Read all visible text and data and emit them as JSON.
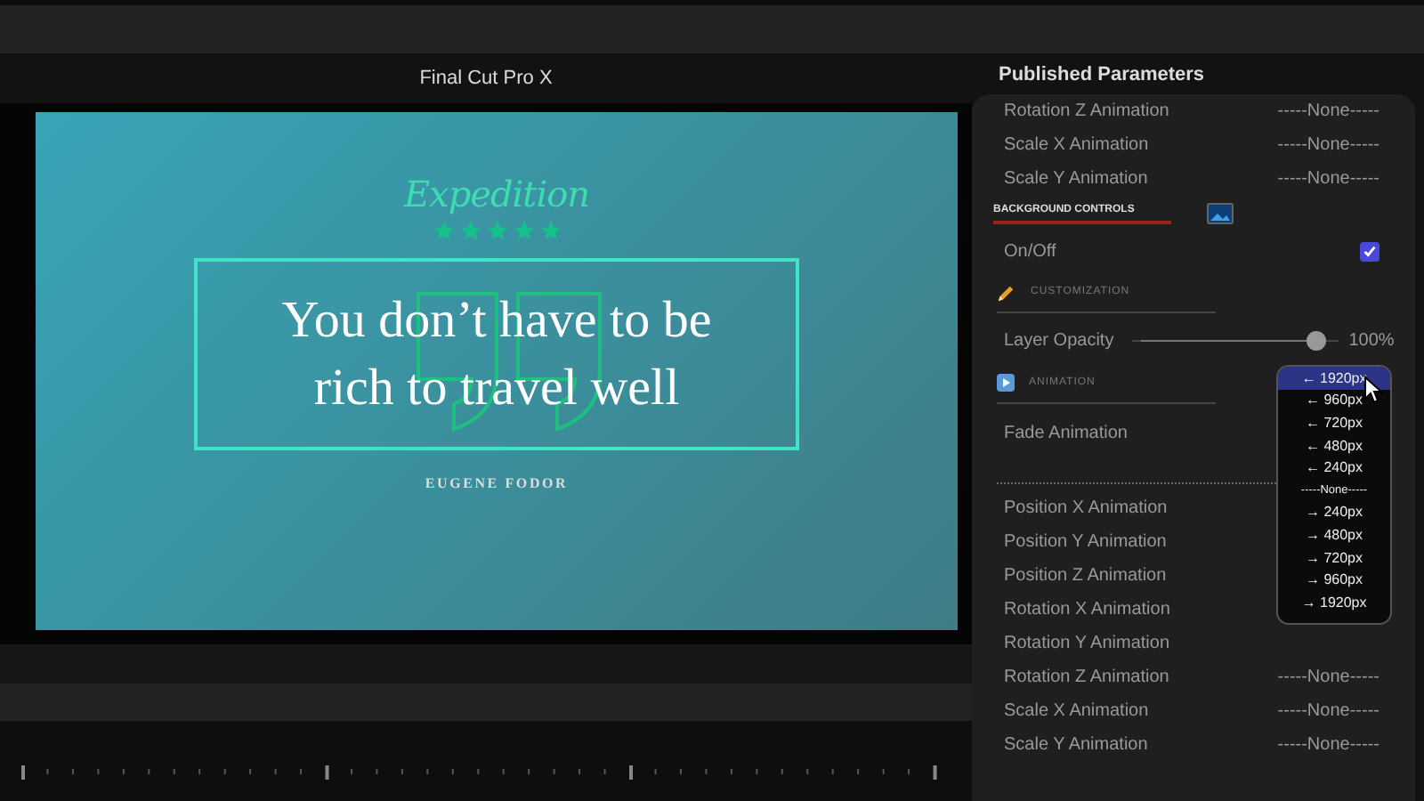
{
  "viewer": {
    "title": "Final Cut Pro X",
    "slide": {
      "heading": "Expedition",
      "stars": 5,
      "quote": "You don’t have to be rich to travel well",
      "author": "EUGENE FODOR"
    }
  },
  "panel": {
    "title": "Published Parameters",
    "rows": [
      {
        "kind": "param",
        "label": "Rotation Z Animation",
        "value": "-----None-----"
      },
      {
        "kind": "param",
        "label": "Scale X Animation",
        "value": "-----None-----"
      },
      {
        "kind": "param",
        "label": "Scale Y Animation",
        "value": "-----None-----"
      },
      {
        "kind": "banner",
        "label": "BACKGROUND CONTROLS"
      },
      {
        "kind": "checkbox",
        "label": "On/Off",
        "checked": true
      },
      {
        "kind": "tools",
        "label": "CUSTOMIZATION"
      },
      {
        "kind": "slider",
        "label": "Layer Opacity",
        "level": 0.93,
        "reading": "100%"
      },
      {
        "kind": "motion",
        "label": "ANIMATION"
      },
      {
        "kind": "param",
        "label": "Fade Animation"
      },
      {
        "kind": "separator"
      },
      {
        "kind": "param",
        "label": "Position X Animation"
      },
      {
        "kind": "param",
        "label": "Position Y Animation"
      },
      {
        "kind": "param",
        "label": "Position Z Animation"
      },
      {
        "kind": "param",
        "label": "Rotation X Animation"
      },
      {
        "kind": "param",
        "label": "Rotation Y Animation"
      },
      {
        "kind": "param",
        "label": "Rotation Z Animation",
        "value": "-----None-----"
      },
      {
        "kind": "param",
        "label": "Scale X Animation",
        "value": "-----None-----"
      },
      {
        "kind": "param",
        "label": "Scale Y Animation",
        "value": "-----None-----"
      }
    ]
  },
  "dropdown": {
    "items": [
      {
        "label": "← 1920px",
        "selected": true
      },
      {
        "label": "← 960px",
        "selected": false
      },
      {
        "label": "← 720px",
        "selected": false
      },
      {
        "label": "← 480px",
        "selected": false
      },
      {
        "label": "← 240px",
        "selected": false
      },
      {
        "label": "-----None-----",
        "selected": false
      },
      {
        "label": "→ 240px",
        "selected": false
      },
      {
        "label": "→ 480px",
        "selected": false
      },
      {
        "label": "→ 720px",
        "selected": false
      },
      {
        "label": "→ 960px",
        "selected": false
      },
      {
        "label": "→ 1920px",
        "selected": false
      }
    ]
  }
}
